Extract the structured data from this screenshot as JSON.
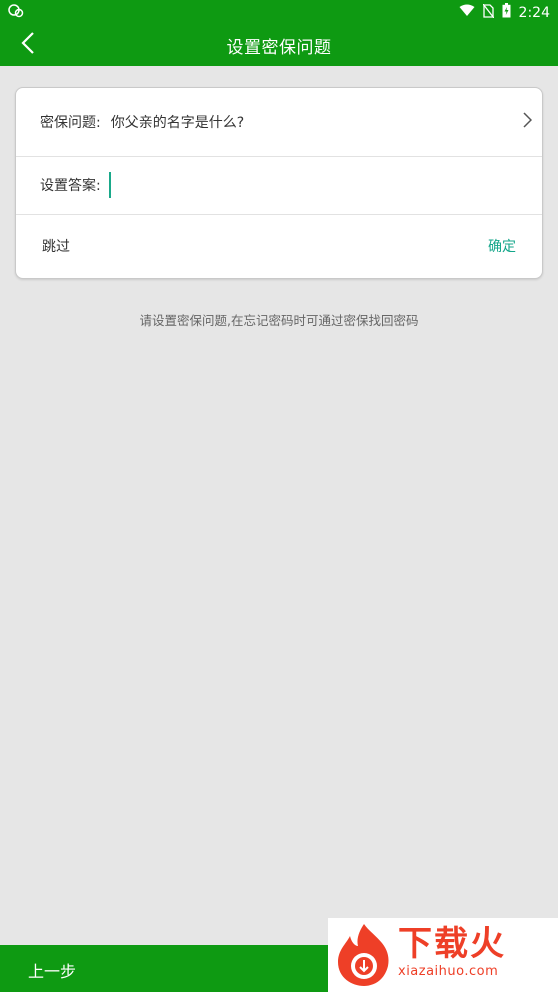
{
  "status_bar": {
    "time": "2:24"
  },
  "app_bar": {
    "title": "设置密保问题"
  },
  "form": {
    "question_label": "密保问题:",
    "question_value": "你父亲的名字是什么?",
    "answer_label": "设置答案:",
    "answer_value": "",
    "skip_label": "跳过",
    "confirm_label": "确定"
  },
  "hint": "请设置密保问题,在忘记密码时可通过密保找回密码",
  "bottom_bar": {
    "prev_label": "上一步"
  },
  "watermark": {
    "brand": "下载火",
    "url": "xiazaihuo.com"
  },
  "colors": {
    "primary": "#0e9a12",
    "accent": "#13a68a",
    "background": "#e6e6e6",
    "watermark": "#ee3f27"
  },
  "icons": {
    "back": "chevron-left-icon",
    "question_arrow": "chevron-right-icon"
  }
}
